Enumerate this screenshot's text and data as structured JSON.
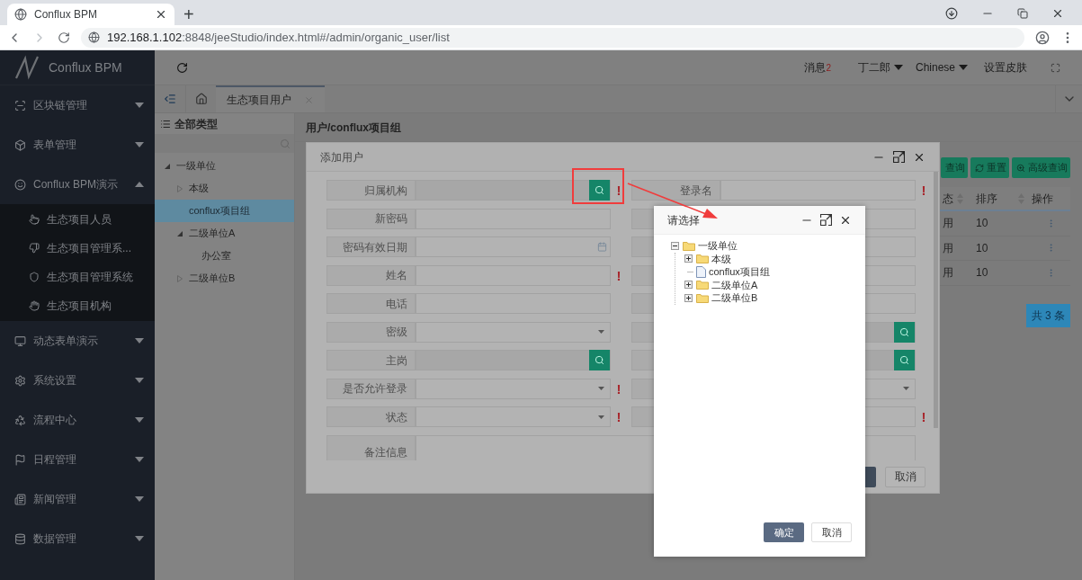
{
  "browser": {
    "tab_title": "Conflux BPM",
    "new_tab": "+",
    "url_host": "192.168.1.102",
    "url_path": ":8848/jeeStudio/index.html#/admin/organic_user/list"
  },
  "sidebar": {
    "brand": "Conflux BPM",
    "items": [
      {
        "label": "区块链管理",
        "expanded": false
      },
      {
        "label": "表单管理",
        "expanded": false
      },
      {
        "label": "Conflux BPM演示",
        "expanded": true,
        "children": [
          {
            "label": "生态项目人员"
          },
          {
            "label": "生态项目管理系..."
          },
          {
            "label": "生态项目管理系统"
          },
          {
            "label": "生态项目机构"
          }
        ]
      },
      {
        "label": "动态表单演示",
        "expanded": false
      },
      {
        "label": "系统设置",
        "expanded": false
      },
      {
        "label": "流程中心",
        "expanded": false
      },
      {
        "label": "日程管理",
        "expanded": false
      },
      {
        "label": "新闻管理",
        "expanded": false
      },
      {
        "label": "数据管理",
        "expanded": false
      }
    ]
  },
  "header": {
    "messages": "消息",
    "message_count": "2",
    "user": "丁二郎",
    "language": "Chinese",
    "skin": "设置皮肤"
  },
  "tabs": [
    {
      "label": "生态项目用户",
      "selected": true
    }
  ],
  "type_panel": {
    "title": "全部类型",
    "tree": [
      {
        "label": "一级单位",
        "kind": "folder",
        "expanded": true,
        "selected": false,
        "children": [
          {
            "label": "本级",
            "kind": "folder",
            "expanded": false,
            "selected": false
          },
          {
            "label": "conflux项目组",
            "kind": "leaf",
            "selected": true
          },
          {
            "label": "二级单位A",
            "kind": "folder",
            "expanded": true,
            "selected": false,
            "children": [
              {
                "label": "办公室",
                "kind": "leaf",
                "selected": false
              }
            ]
          },
          {
            "label": "二级单位B",
            "kind": "folder",
            "expanded": false,
            "selected": false
          }
        ]
      }
    ]
  },
  "list": {
    "breadcrumb": "用户/conflux项目组",
    "buttons": [
      {
        "label": "查询",
        "kind": "plain"
      },
      {
        "label": "重置",
        "kind": "reset"
      },
      {
        "label": "高级查询",
        "kind": "advanced"
      }
    ],
    "columns": [
      {
        "label": "态",
        "sortable": true
      },
      {
        "label": "排序",
        "sortable": true
      },
      {
        "label": "操作",
        "sortable": false
      }
    ],
    "rows": [
      {
        "cells": [
          "用",
          "10"
        ]
      },
      {
        "cells": [
          "用",
          "10"
        ]
      },
      {
        "cells": [
          "用",
          "10"
        ]
      }
    ],
    "total": "共 3 条"
  },
  "user_dialog": {
    "title": "添加用户",
    "left_fields": [
      {
        "label": "归属机构",
        "kind": "lookup",
        "required": true
      },
      {
        "label": "新密码",
        "kind": "text",
        "required": false
      },
      {
        "label": "密码有效日期",
        "kind": "date",
        "required": false
      },
      {
        "label": "姓名",
        "kind": "text",
        "required": true
      },
      {
        "label": "电话",
        "kind": "text",
        "required": false
      },
      {
        "label": "密级",
        "kind": "select",
        "required": false
      },
      {
        "label": "主岗",
        "kind": "lookup",
        "required": false
      },
      {
        "label": "是否允许登录",
        "kind": "select",
        "required": true
      },
      {
        "label": "状态",
        "kind": "select",
        "required": true
      }
    ],
    "right_fields": [
      {
        "label": "登录名",
        "kind": "text",
        "required": true
      },
      {
        "kind": "text",
        "required": false
      },
      {
        "kind": "text",
        "required": false
      },
      {
        "kind": "text",
        "required": false
      },
      {
        "kind": "text",
        "required": false
      },
      {
        "kind": "lookup",
        "required": false
      },
      {
        "kind": "lookup",
        "required": false
      },
      {
        "kind": "select",
        "required": false
      },
      {
        "kind": "text",
        "required": true
      }
    ],
    "remarks_label": "备注信息",
    "required_mark": "!",
    "buttons": [
      {
        "kind": "primary"
      },
      {
        "kind": "default",
        "label": "取消"
      }
    ]
  },
  "select_dialog": {
    "title": "请选择",
    "tree": [
      {
        "label": "一级单位",
        "kind": "folder",
        "expanded": true,
        "children": [
          {
            "label": "本级",
            "kind": "folder",
            "expanded": false
          },
          {
            "label": "conflux项目组",
            "kind": "leaf"
          },
          {
            "label": "二级单位A",
            "kind": "folder",
            "expanded": false
          },
          {
            "label": "二级单位B",
            "kind": "folder",
            "expanded": false
          }
        ]
      }
    ],
    "buttons": [
      {
        "kind": "primary",
        "label": "确定"
      },
      {
        "kind": "default",
        "label": "取消"
      }
    ]
  },
  "annotations": {
    "highlight_box": true,
    "arrow": true
  }
}
